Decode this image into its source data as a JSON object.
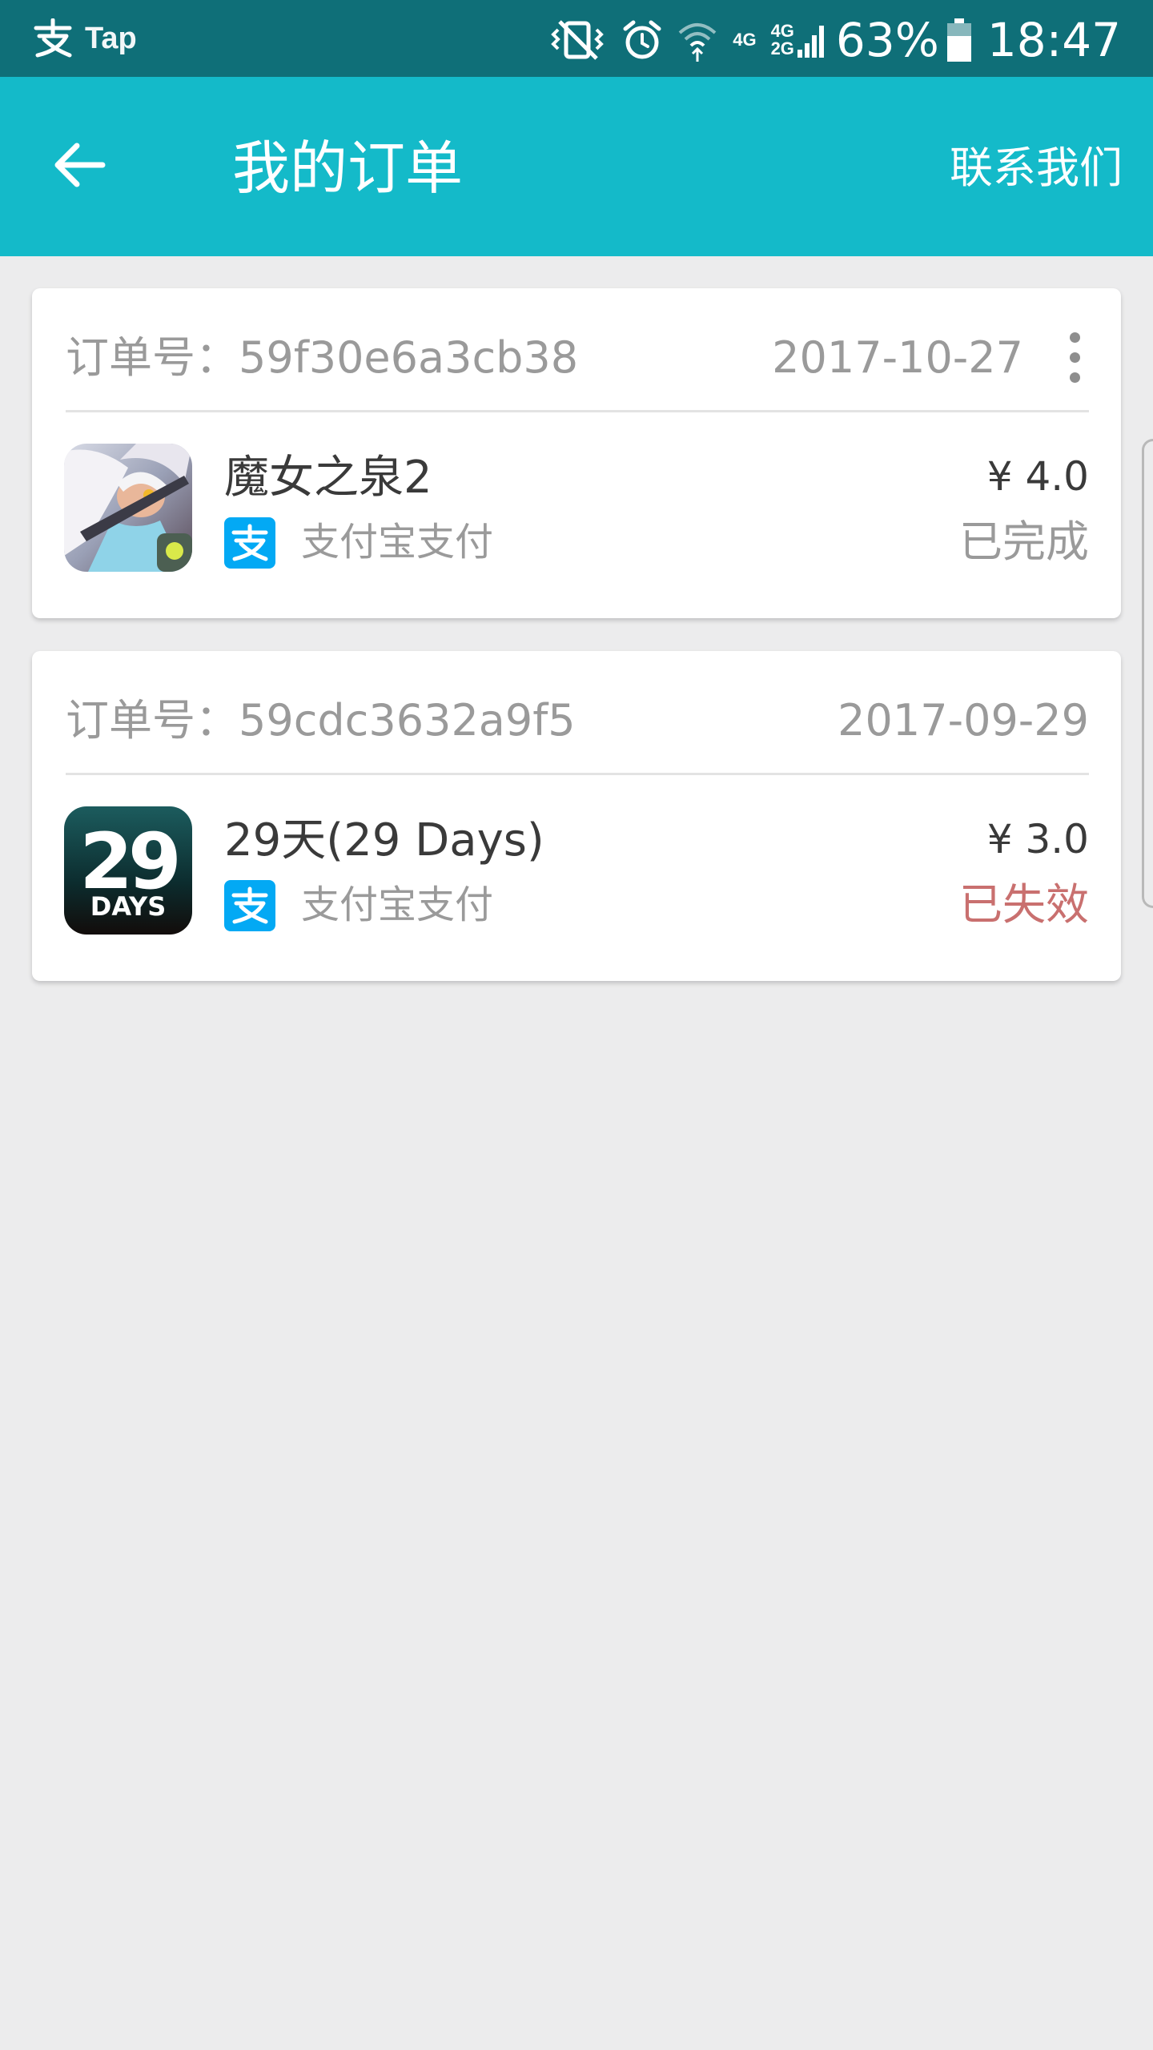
{
  "status_bar": {
    "app_name": "Tap",
    "app_icon": "alipay-zhi-icon",
    "network_4g": "4G",
    "network_4g_2": "4G",
    "network_2g": "2G",
    "battery_percent": "63%",
    "time": "18:47",
    "icons": [
      "vibrate-icon",
      "alarm-icon",
      "wifi-icon",
      "signal-icon",
      "battery-icon"
    ]
  },
  "app_bar": {
    "title": "我的订单",
    "contact_label": "联系我们",
    "background_color": "#14bac9"
  },
  "orders": [
    {
      "order_number": "订单号：59f30e6a3cb38",
      "date": "2017-10-27",
      "game_title": "魔女之泉2",
      "payment_method": "支付宝支付",
      "price": "¥ 4.0",
      "status": "已完成",
      "status_color": "#9a9a9a"
    },
    {
      "order_number": "订单号：59cdc3632a9f5",
      "date": "2017-09-29",
      "game_title": "29天(29 Days)",
      "payment_method": "支付宝支付",
      "price": "¥ 3.0",
      "status": "已失效",
      "status_color": "#c9706f",
      "icon_text_big": "29",
      "icon_text_small": "DAYS"
    }
  ],
  "colors": {
    "status_bar": "#0f6f78",
    "alipay_blue": "#03a9f4",
    "background": "#ececed"
  }
}
